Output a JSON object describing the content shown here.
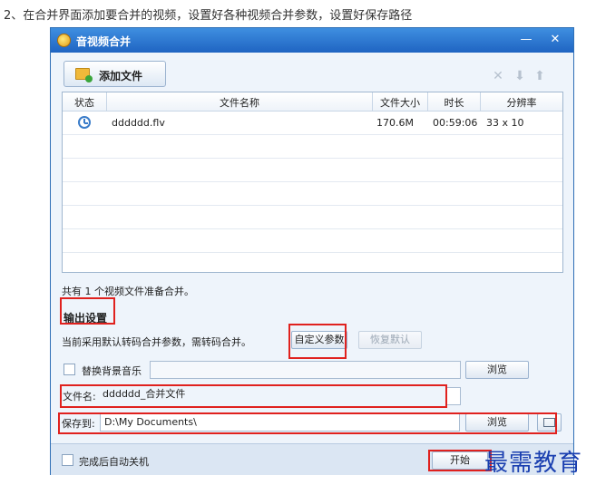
{
  "caption": "2、在合并界面添加要合并的视频，设置好各种视频合并参数，设置好保存路径",
  "window": {
    "title": "音视频合并",
    "minimize_glyph": "—",
    "close_glyph": "✕"
  },
  "toolbar": {
    "add_file_label": "添加文件",
    "actions": [
      {
        "icon": "delete-icon",
        "glyph": "✕"
      },
      {
        "icon": "move-down-icon",
        "glyph": "⬇"
      },
      {
        "icon": "move-up-icon",
        "glyph": "⬆"
      }
    ]
  },
  "table": {
    "columns": [
      "状态",
      "文件名称",
      "文件大小",
      "时长",
      "分辨率"
    ],
    "rows": [
      {
        "status_icon": "clock-icon",
        "name": "dddddd.flv",
        "size": "170.6M",
        "duration": "00:59:06",
        "resolution": "33 x 10"
      }
    ]
  },
  "info_text": "共有 1 个视频文件准备合并。",
  "output": {
    "section_title": "输出设置",
    "note": "当前采用默认转码合并参数，需转码合并。",
    "custom_params_label": "自定义参数",
    "restore_default_label": "恢复默认",
    "replace_music_label": "替换背景音乐",
    "replace_music_value": "",
    "browse_label": "浏览",
    "filename_label": "文件名:",
    "filename_value": "dddddd_合并文件",
    "save_to_label": "保存到:",
    "save_to_value": "D:\\My Documents\\"
  },
  "footer": {
    "auto_shutdown_label": "完成后自动关机",
    "start_label": "开始"
  },
  "watermark": "最需教育",
  "colors": {
    "titlebar": "#1f64c2",
    "highlight": "#e0211e",
    "window_bg": "#eef4fb"
  }
}
